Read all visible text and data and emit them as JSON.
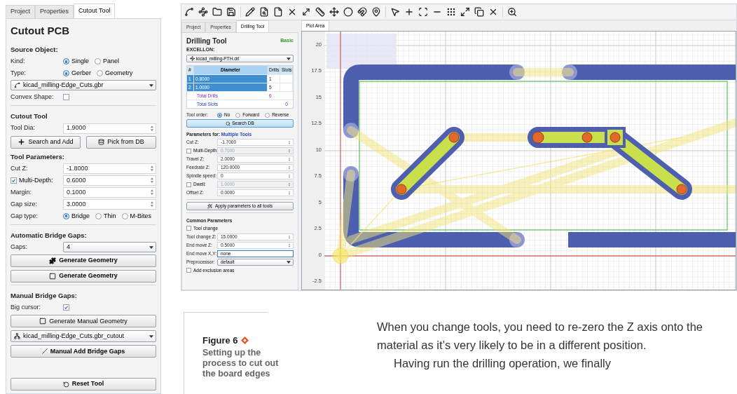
{
  "cutout_panel": {
    "tabs": [
      {
        "label": "Project",
        "selected": false
      },
      {
        "label": "Properties",
        "selected": false
      },
      {
        "label": "Cutout Tool",
        "selected": true
      }
    ],
    "title": "Cutout PCB",
    "source_heading": "Source Object:",
    "source_rows": [
      {
        "kind": "radio",
        "label": "Kind:",
        "options": [
          {
            "label": "Single",
            "selected": true
          },
          {
            "label": "Panel",
            "selected": false
          }
        ]
      },
      {
        "kind": "radio",
        "label": "Type:",
        "options": [
          {
            "label": "Gerber",
            "selected": true
          },
          {
            "label": "Geometry",
            "selected": false
          }
        ]
      },
      {
        "kind": "object_select",
        "value": "kicad_milling-Edge_Cuts.gbr"
      },
      {
        "kind": "check",
        "label": "Convex Shape:",
        "checked": false
      }
    ],
    "cutout_heading": "Cutout Tool",
    "cutout_rows": [
      {
        "kind": "spin",
        "label": "Tool Dia:",
        "value": "1.9000"
      }
    ],
    "tool_buttons": [
      "Search and Add",
      "Pick from DB"
    ],
    "params_heading": "Tool Parameters:",
    "params": [
      {
        "kind": "spin",
        "label": "Cut Z:",
        "value": "-1.8000"
      },
      {
        "kind": "check_spin",
        "label": "Multi-Depth:",
        "checked": true,
        "value": "0.6000"
      },
      {
        "kind": "spin",
        "label": "Margin:",
        "value": "0.1000"
      },
      {
        "kind": "spin",
        "label": "Gap size:",
        "value": "3.0000"
      },
      {
        "kind": "radio",
        "label": "Gap type:",
        "options": [
          {
            "label": "Bridge",
            "selected": true
          },
          {
            "label": "Thin",
            "selected": false
          },
          {
            "label": "M-Bites",
            "selected": false
          }
        ]
      }
    ],
    "auto_heading": "Automatic Bridge Gaps:",
    "auto_rows": [
      {
        "kind": "select",
        "label": "Gaps:",
        "value": "4"
      }
    ],
    "generate_buttons": [
      {
        "kind": "freeform",
        "label": "Generate Geometry"
      },
      {
        "kind": "rectangle",
        "label": "Generate Geometry"
      }
    ],
    "manual_heading": "Manual Bridge Gaps:",
    "manual_rows": [
      {
        "kind": "check",
        "label": "Big cursor:",
        "checked": true
      }
    ],
    "manual_geometry_button": "Generate Manual Geometry",
    "manual_select": "kicad_milling-Edge_Cuts.gbr_cutout",
    "manual_add_button": "Manual Add Bridge Gaps",
    "reset_button": "Reset Tool"
  },
  "drill_panel": {
    "tabs": [
      {
        "label": "Project",
        "selected": false
      },
      {
        "label": "Properties",
        "selected": false
      },
      {
        "label": "Drilling Tool",
        "selected": true
      }
    ],
    "title": "Drilling Tool",
    "mode": "Basic",
    "excellon_label": "EXCELLON:",
    "excellon_select": "kicad_milling-PTH.drl",
    "table": {
      "columns": [
        "#",
        "Diameter",
        "Drills",
        "Slots"
      ],
      "rows": [
        {
          "cells": [
            "1",
            "0.8000",
            "1",
            ""
          ],
          "selected": true
        },
        {
          "cells": [
            "2",
            "1.0000",
            "5",
            ""
          ],
          "selected": true
        }
      ],
      "totals": [
        {
          "kind": "drills",
          "label": "Total Drills",
          "value": "6"
        },
        {
          "kind": "slots",
          "label": "Total Slots",
          "value": "0"
        }
      ]
    },
    "tool_order": {
      "kind": "radio",
      "label": "Tool order:",
      "options": [
        {
          "label": "No",
          "selected": true
        },
        {
          "label": "Forward",
          "selected": false
        },
        {
          "label": "Reverse",
          "selected": false
        }
      ]
    },
    "search_button": "Search DB",
    "params_heading": "Parameters for: ",
    "params_target": "Multiple Tools",
    "params": [
      {
        "kind": "spin",
        "label": "Cut Z:",
        "value": "-1.7000"
      },
      {
        "kind": "check_spin",
        "label": "Multi-Depth:",
        "checked": false,
        "value": "0.7000"
      },
      {
        "kind": "spin",
        "label": "Travel Z:",
        "value": "2.0000"
      },
      {
        "kind": "spin",
        "label": "Feedrate Z:",
        "value": "120.0000"
      },
      {
        "kind": "spin",
        "label": "Spindle speed:",
        "value": "0"
      },
      {
        "kind": "check_spin",
        "label": "Dwell:",
        "checked": false,
        "value": "1.0000"
      },
      {
        "kind": "spin",
        "label": "Offset Z:",
        "value": "0.0000"
      }
    ],
    "apply_button": "Apply parameters to all tools",
    "common_heading": "Common Parameters",
    "common": [
      {
        "kind": "check",
        "label": "Tool change",
        "checked": false
      },
      {
        "kind": "spin",
        "label": "Tool change Z:",
        "value": "15.0000"
      },
      {
        "kind": "spin",
        "label": "End move Z:",
        "value": "0.5000"
      },
      {
        "kind": "text",
        "label": "End move X,Y:",
        "value": "none"
      },
      {
        "kind": "select",
        "label": "Preprocessor:",
        "value": "default"
      },
      {
        "kind": "check",
        "label": "Add exclusion areas",
        "checked": false
      }
    ]
  },
  "plot": {
    "tab": "Plot Area",
    "yticks": [
      "20",
      "17.5",
      "15",
      "12.5",
      "10",
      "7.5",
      "5",
      "2.5",
      "0",
      "-2.5"
    ]
  },
  "figure": {
    "label": "Figure 6",
    "caption": "Setting up the process to cut out the board edges"
  },
  "body": [
    "When you change tools, you need to re-zero the Z axis onto the material as it’s very likely to be in a different position.",
    "Having run the drilling operation, we finally"
  ]
}
